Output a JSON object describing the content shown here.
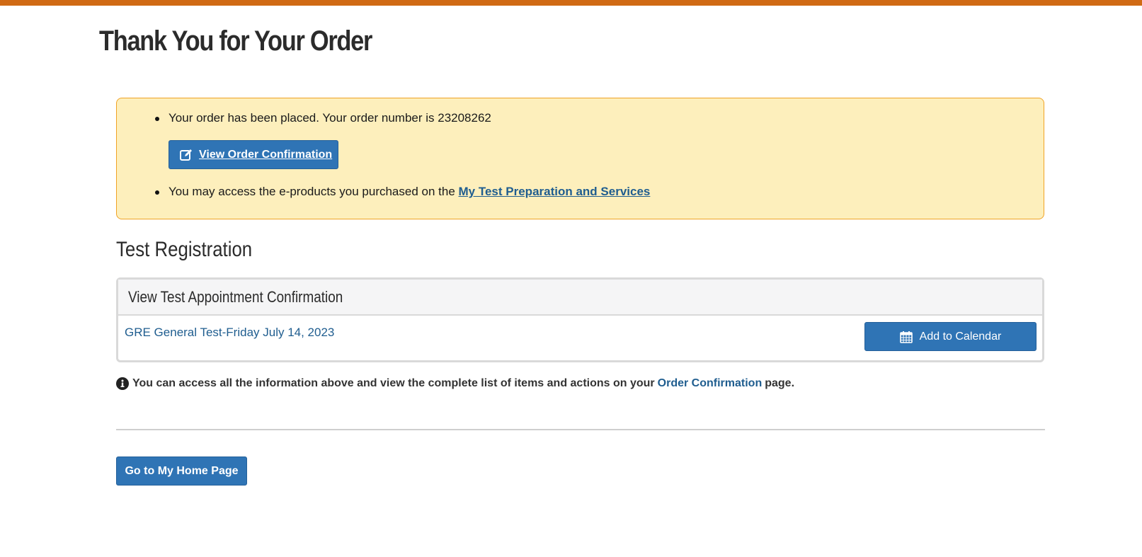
{
  "page": {
    "title": "Thank You for Your Order"
  },
  "alert": {
    "order_placed_text": "Your order has been placed. Your order number is 23208262",
    "view_order_button": "View Order Confirmation",
    "eproducts_text": "You may access the e-products you purchased on the ",
    "eproducts_link": "My Test Preparation and Services"
  },
  "registration": {
    "section_title": "Test Registration",
    "panel_title": "View Test Appointment Confirmation",
    "test_link": "GRE General Test-Friday July 14, 2023",
    "add_calendar_button": "Add to Calendar"
  },
  "info": {
    "text_before": "You can access all the information above and view the complete list of items and actions on your",
    "link": "Order Confirmation",
    "text_after": "page."
  },
  "home_button": "Go to My Home Page",
  "colors": {
    "accent_bar": "#d06a14",
    "button_blue": "#2f74b5",
    "alert_bg": "#fdefbc",
    "alert_border": "#f0a325",
    "link": "#1f5d8f"
  },
  "icons": {
    "view_order": "edit-icon",
    "calendar": "calendar-icon",
    "info": "info-circle-icon"
  }
}
